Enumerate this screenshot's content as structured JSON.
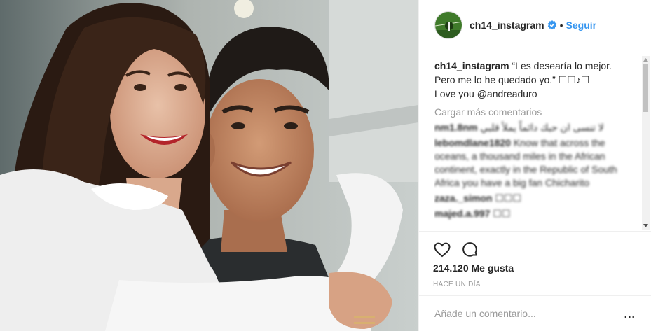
{
  "header": {
    "username": "ch14_instagram",
    "separator": "•",
    "follow_label": "Seguir"
  },
  "photo": {
    "icon": "photo-couple-selfie"
  },
  "caption": {
    "username": "ch14_instagram",
    "text": "“Les desearía lo mejor.\nPero me lo he quedado yo.” ☐☐♪☐\nLove you @andreaduro"
  },
  "comments": {
    "load_more": "Cargar más comentarios",
    "items": [
      {
        "user": "nm1.8nm",
        "text": "لا تنسى ان حبك دائماً يملأ قلبي"
      },
      {
        "user": "lebomdlane1820",
        "text": "Know that across the oceans, a thousand miles in the African continent, exactly in the Republic of South Africa you have a big fan Chicharito"
      },
      {
        "user": "zaza._simon",
        "text": "☐☐☐"
      },
      {
        "user": "majed.a.997",
        "text": "☐☐"
      }
    ]
  },
  "actions": {
    "like_icon": "heart-icon",
    "comment_icon": "comment-icon",
    "likes": "214.120 Me gusta",
    "time": "Hace un día"
  },
  "add_comment": {
    "placeholder": "Añade un comentario...",
    "more": "..."
  },
  "colors": {
    "link": "#3897f0",
    "text": "#262626",
    "muted": "#999999",
    "verified": "#3897f0"
  }
}
